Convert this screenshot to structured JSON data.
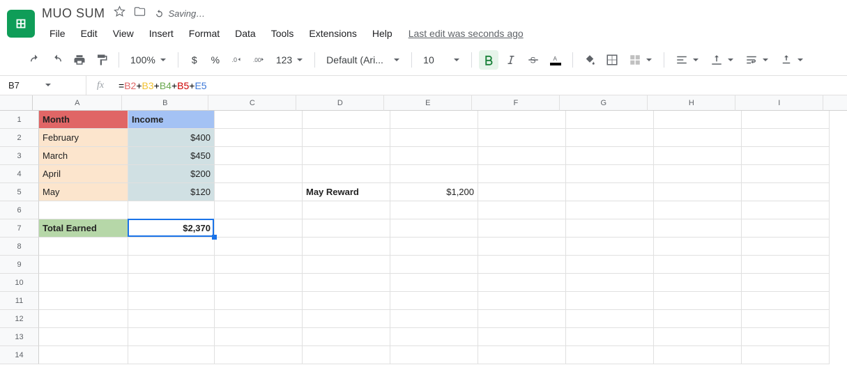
{
  "doc": {
    "title": "MUO SUM",
    "saving": "Saving…",
    "last_edit": "Last edit was seconds ago"
  },
  "menu": {
    "file": "File",
    "edit": "Edit",
    "view": "View",
    "insert": "Insert",
    "format": "Format",
    "data": "Data",
    "tools": "Tools",
    "extensions": "Extensions",
    "help": "Help"
  },
  "toolbar": {
    "zoom": "100%",
    "format_num": "123",
    "font": "Default (Ari...",
    "font_size": "10"
  },
  "namebox": "B7",
  "formula": {
    "eq": "=",
    "b2": "B2",
    "plus": "+",
    "b3": "B3",
    "b4": "B4",
    "b5": "B5",
    "e5": "E5"
  },
  "columns": [
    "A",
    "B",
    "C",
    "D",
    "E",
    "F",
    "G",
    "H",
    "I"
  ],
  "rows": [
    "1",
    "2",
    "3",
    "4",
    "5",
    "6",
    "7",
    "8",
    "9",
    "10",
    "11",
    "12",
    "13",
    "14"
  ],
  "cells": {
    "A1": "Month",
    "B1": "Income",
    "A2": "February",
    "B2": "$400",
    "A3": "March",
    "B3": "$450",
    "A4": "April",
    "B4": "$200",
    "A5": "May",
    "B5": "$120",
    "D5": "May Reward",
    "E5": "$1,200",
    "A7": "Total Earned",
    "B7": "$2,370"
  },
  "col_widths": {
    "A": 128,
    "B": 124,
    "C": 126,
    "D": 126,
    "E": 126,
    "F": 126,
    "G": 126,
    "H": 126,
    "I": 126
  },
  "active": {
    "ref": "B7"
  },
  "chart_data": null
}
